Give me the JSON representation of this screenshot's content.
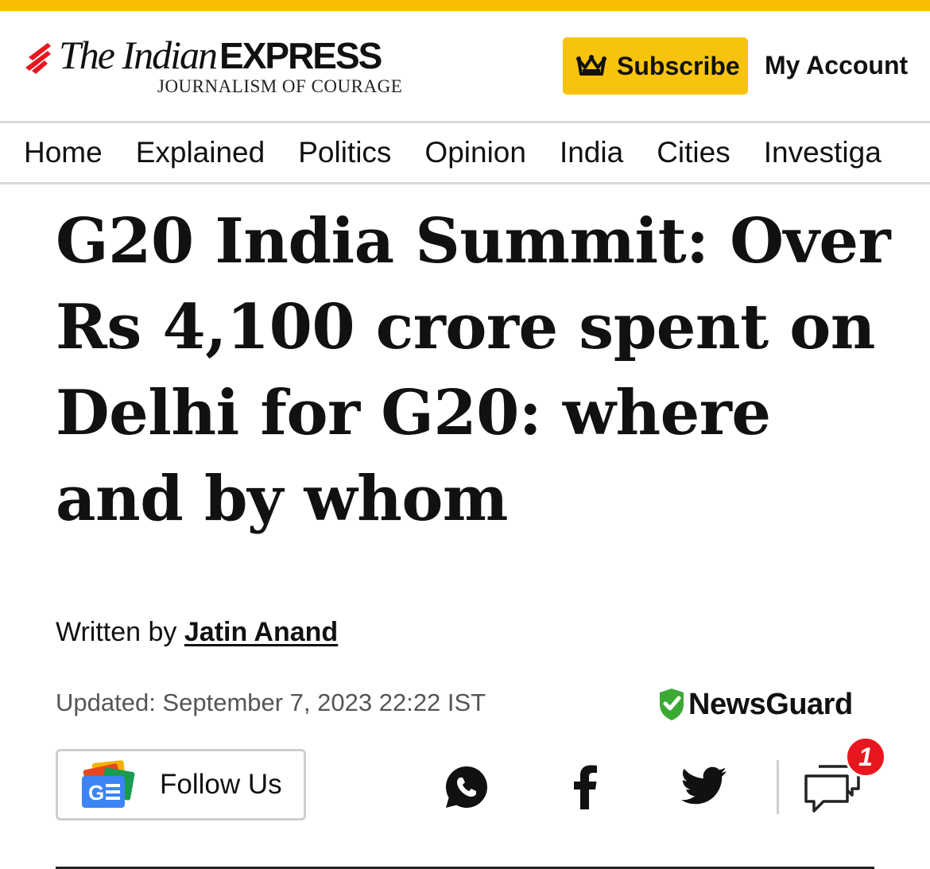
{
  "brand": {
    "name_serif": "The Indian",
    "name_caps": "EXPRESS",
    "tagline": "JOURNALISM OF COURAGE",
    "stripe_color": "#f8bf00",
    "accent_red": "#e8161e"
  },
  "header": {
    "subscribe_label": "Subscribe",
    "subscribe_icon": "crown-icon",
    "account_label": "My Account"
  },
  "nav": {
    "items": [
      {
        "label": "Home"
      },
      {
        "label": "Explained"
      },
      {
        "label": "Politics"
      },
      {
        "label": "Opinion"
      },
      {
        "label": "India"
      },
      {
        "label": "Cities"
      },
      {
        "label": "Investiga"
      }
    ]
  },
  "article": {
    "headline": "G20 India Summit: Over Rs 4,100 crore spent on Delhi for G20: where and by whom",
    "byline_prefix": "Written by ",
    "author": "Jatin Anand",
    "updated": "Updated: September 7, 2023 22:22 IST"
  },
  "newsguard": {
    "label": "NewsGuard",
    "icon": "newsguard-shield-check-icon",
    "color": "#3aaa35"
  },
  "follow": {
    "label": "Follow Us",
    "icon": "google-news-icon"
  },
  "share": {
    "icons": [
      "whatsapp-icon",
      "facebook-icon",
      "twitter-icon",
      "comments-icon"
    ],
    "comment_count": "1"
  }
}
